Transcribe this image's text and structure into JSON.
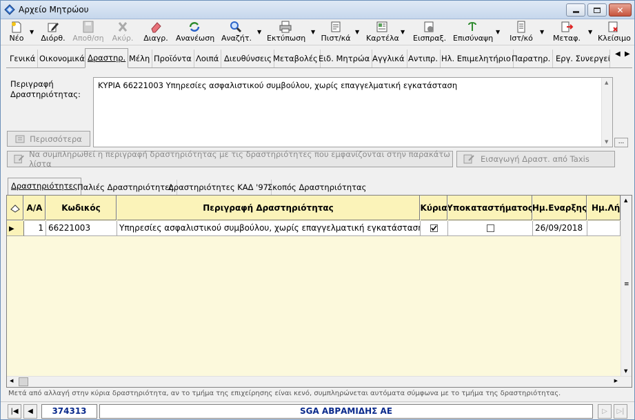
{
  "window": {
    "title": "Αρχείο Μητρώου"
  },
  "toolbar": {
    "buttons": [
      {
        "label": "Νέο",
        "icon": "new-icon"
      },
      {
        "label": "Διόρθ.",
        "icon": "edit-icon"
      },
      {
        "label": "Αποθ/ση",
        "icon": "save-icon",
        "disabled": true
      },
      {
        "label": "Ακύρ.",
        "icon": "cancel-icon",
        "disabled": true
      },
      {
        "label": "Διαγρ.",
        "icon": "eraser-icon"
      },
      {
        "label": "Ανανέωση",
        "icon": "refresh-icon"
      },
      {
        "label": "Αναζήτ.",
        "icon": "search-icon"
      },
      {
        "label": "Εκτύπωση",
        "icon": "print-icon"
      },
      {
        "label": "Πιστ/κά",
        "icon": "certificate-icon"
      },
      {
        "label": "Καρτέλα",
        "icon": "card-icon"
      },
      {
        "label": "Εισπραξ.",
        "icon": "collection-icon"
      },
      {
        "label": "Επισύναψη",
        "icon": "attach-icon"
      },
      {
        "label": "Ιστ/κό",
        "icon": "history-icon"
      },
      {
        "label": "Μεταφ.",
        "icon": "transfer-icon"
      },
      {
        "label": "Κλείσιμο",
        "icon": "close-icon"
      }
    ]
  },
  "main_tabs": [
    "Γενικά",
    "Οικονομικά",
    "Δραστηρ.",
    "Μέλη",
    "Προϊόντα",
    "Λοιπά",
    "Διευθύνσεις",
    "Μεταβολές",
    "Ειδ. Μητρώα",
    "Αγγλικά",
    "Αντιπρ.",
    "Ηλ. Επιμελητήριο",
    "Παρατηρ.",
    "Εργ. Συνεργεί"
  ],
  "activity": {
    "label": "Περιγραφή Δραστηριότητας:",
    "value": "ΚΥΡΙΑ 66221003 Υπηρεσίες ασφαλιστικού συμβούλου, χωρίς επαγγελματική εγκατάσταση",
    "more_button": "Περισσότερα",
    "dots_button": "...",
    "fill_button": "Να συμπληρωθεί η περιγραφή δραστηριότητας με τις δραστηριότητες που εμφανίζονται στην παρακάτω λίστα",
    "taxis_button": "Εισαγωγή Δραστ. από Taxis"
  },
  "sub_tabs": [
    "Δραστηριότητες",
    "Παλιές Δραστηριότητες",
    "Δραστηριότητες ΚΑΔ '97",
    "Σκοπός Δραστηριότητας"
  ],
  "grid": {
    "columns": [
      "Α/Α",
      "Κωδικός",
      "Περιγραφή Δραστηριότητας",
      "Κύρια",
      "Υποκαταστήματος",
      "Ημ.Εναρξης",
      "Ημ.Λήξ"
    ],
    "rows": [
      {
        "aa": "1",
        "code": "66221003",
        "desc": "Υπηρεσίες ασφαλιστικού συμβούλου, χωρίς επαγγελματική εγκατάσταση",
        "main": true,
        "branch": false,
        "start": "26/09/2018",
        "end": ""
      }
    ]
  },
  "hint": "Μετά από αλλαγή στην κύρια δραστηριότητα, αν το τμήμα της επιχείρησης είναι κενό, συμπληρώνεται αυτόματα σύμφωνα με το τμήμα της δραστηριότητας.",
  "status": {
    "code": "374313",
    "name": "SGA ΑΒΡΑΜΙΔΗΣ ΑΕ"
  }
}
